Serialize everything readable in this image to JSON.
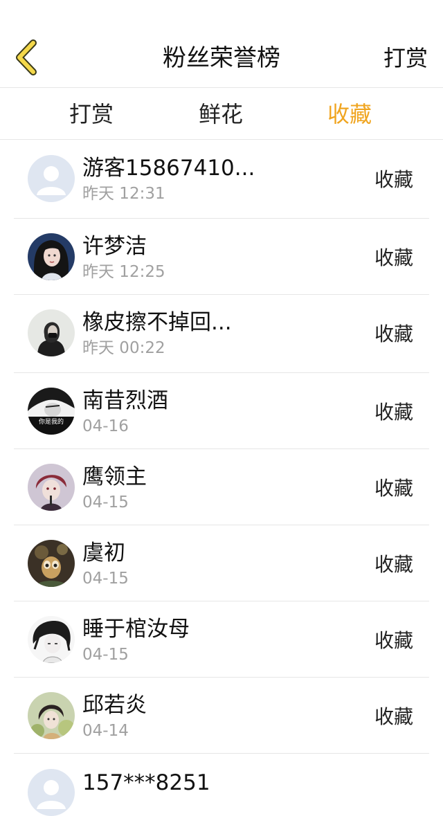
{
  "header": {
    "title": "粉丝荣誉榜",
    "right_action": "打赏"
  },
  "tabs": [
    {
      "label": "打赏",
      "active": false
    },
    {
      "label": "鲜花",
      "active": false
    },
    {
      "label": "收藏",
      "active": true
    }
  ],
  "colors": {
    "accent": "#f0a520",
    "back_icon": "#f4d84a",
    "divider": "#e6e6e6"
  },
  "fans": [
    {
      "name": "游客15867410...",
      "time": "昨天 12:31",
      "action": "收藏",
      "avatar": "default-avatar"
    },
    {
      "name": "许梦洁",
      "time": "昨天 12:25",
      "action": "收藏",
      "avatar": "user-avatar"
    },
    {
      "name": "橡皮擦不掉回...",
      "time": "昨天 00:22",
      "action": "收藏",
      "avatar": "user-avatar"
    },
    {
      "name": "南昔烈酒",
      "time": "04-16",
      "action": "收藏",
      "avatar": "user-avatar"
    },
    {
      "name": "鹰领主",
      "time": "04-15",
      "action": "收藏",
      "avatar": "user-avatar"
    },
    {
      "name": "虞初",
      "time": "04-15",
      "action": "收藏",
      "avatar": "user-avatar"
    },
    {
      "name": "睡于棺汝母",
      "time": "04-15",
      "action": "收藏",
      "avatar": "user-avatar"
    },
    {
      "name": "邱若炎",
      "time": "04-14",
      "action": "收藏",
      "avatar": "user-avatar"
    },
    {
      "name": "157***8251",
      "avatar": "default-avatar"
    }
  ],
  "avatar_text": {
    "nanxi": "你是我的"
  }
}
